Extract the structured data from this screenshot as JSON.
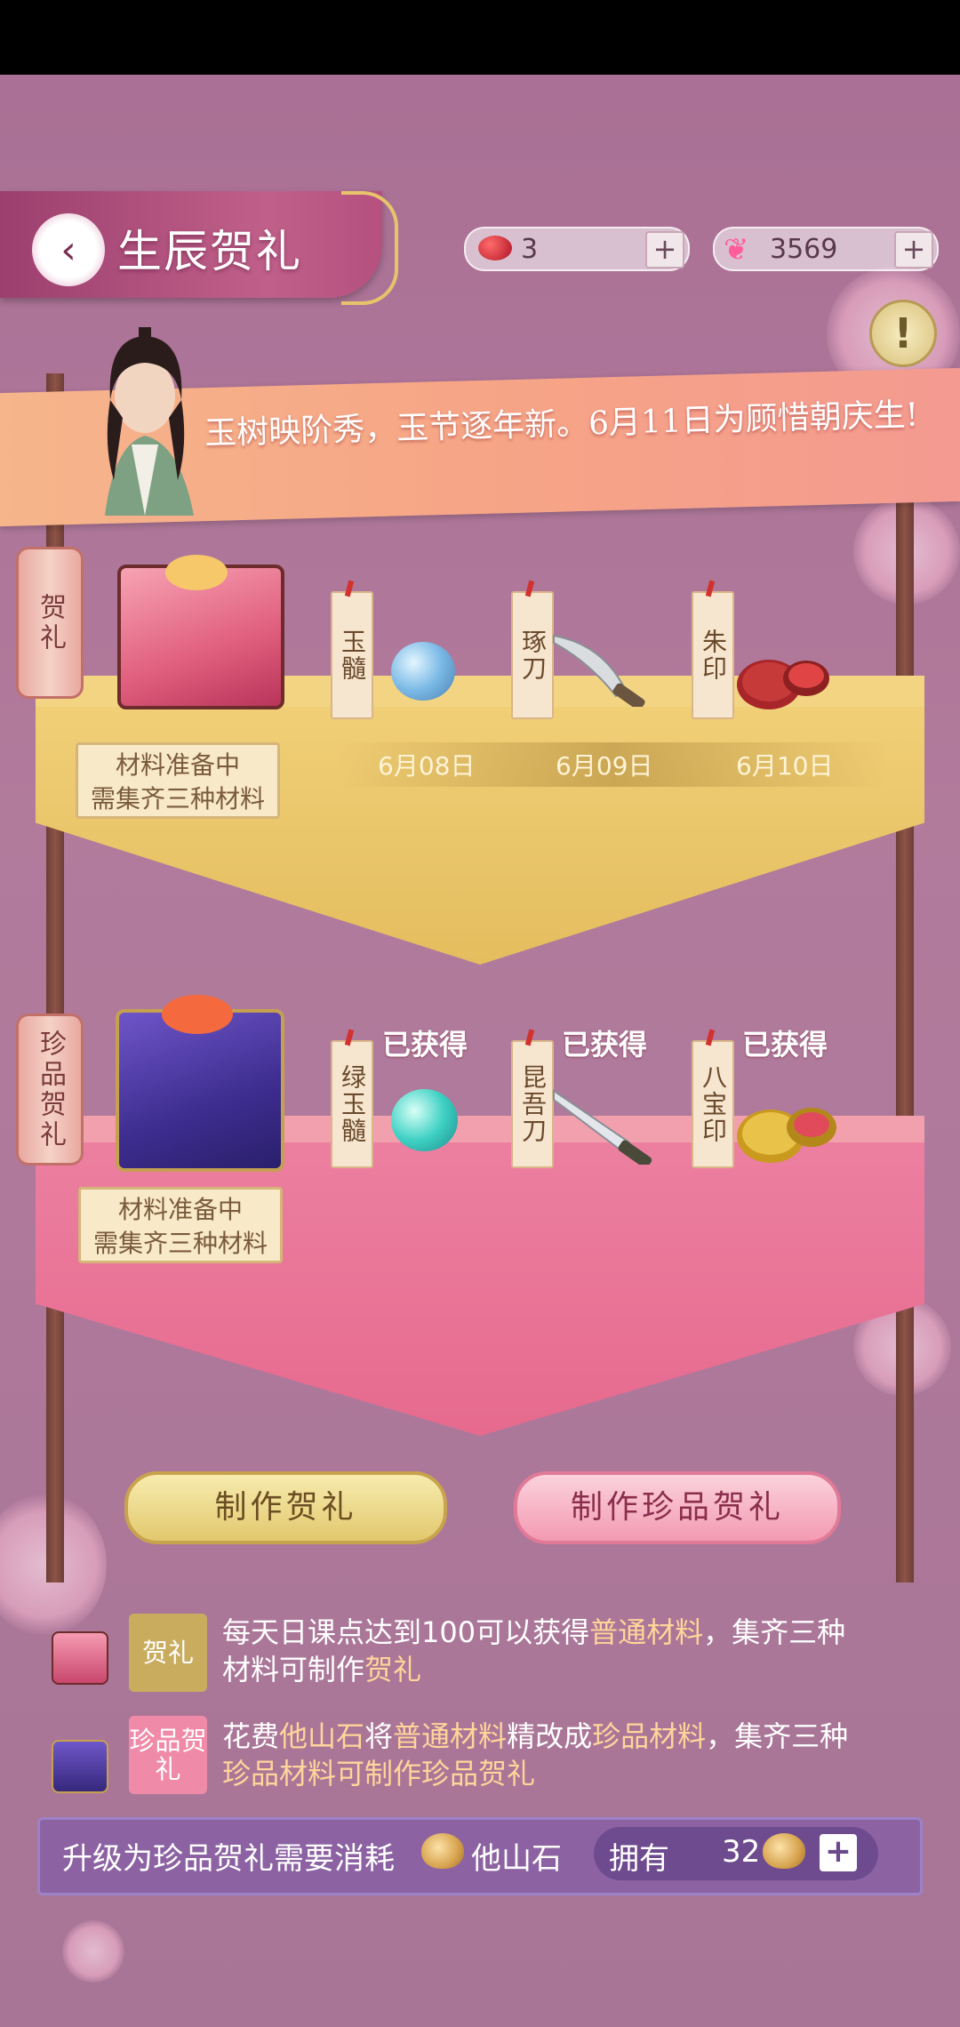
{
  "header": {
    "title": "生辰贺礼",
    "back_icon": "chevron-left-icon"
  },
  "currencies": [
    {
      "icon": "red-bean-icon",
      "value": "3",
      "plus": "+"
    },
    {
      "icon": "butterfly-icon",
      "value": "3569",
      "plus": "+"
    }
  ],
  "info_button": "!",
  "announcement": "玉树映阶秀，玉节逐年新。6月11日为顾惜朝庆生!",
  "gift_row": {
    "lantern": "贺礼",
    "status": [
      "材料准备中",
      "需集齐三种材料"
    ],
    "materials": [
      {
        "tag": "玉髓",
        "date": "6月08日"
      },
      {
        "tag": "琢刀",
        "date": "6月09日"
      },
      {
        "tag": "朱印",
        "date": "6月10日"
      }
    ]
  },
  "precious_row": {
    "lantern": "珍品贺礼",
    "status": [
      "材料准备中",
      "需集齐三种材料"
    ],
    "materials": [
      {
        "tag": "绿玉髓",
        "state": "已获得"
      },
      {
        "tag": "昆吾刀",
        "state": "已获得"
      },
      {
        "tag": "八宝印",
        "state": "已获得"
      }
    ]
  },
  "buttons": {
    "make_gift": "制作贺礼",
    "make_precious": "制作珍品贺礼"
  },
  "info_rows": [
    {
      "chip": "贺礼",
      "text_a": "每天日课点达到100可以获得",
      "text_hl1": "普通材料",
      "text_b": "，集齐三种",
      "text_c": "材料可制作",
      "text_hl2": "贺礼"
    },
    {
      "chip": "珍品贺礼",
      "text_a": "花费",
      "text_hl1": "他山石",
      "text_b": "将",
      "text_hl2": "普通材料",
      "text_c": "精改成",
      "text_hl3": "珍品材料",
      "text_d": "，集齐三种",
      "text_e": "珍品材料可制作",
      "text_hl4": "珍品贺礼"
    }
  ],
  "bottom": {
    "upgrade_text": "升级为珍品贺礼需要消耗",
    "stone_name": "他山石",
    "own_label": "拥有",
    "own_count": "32",
    "plus": "+"
  },
  "colors": {
    "accent_pink": "#e66a8e",
    "accent_gold": "#e4bd5e",
    "bg": "#b07a9c"
  }
}
